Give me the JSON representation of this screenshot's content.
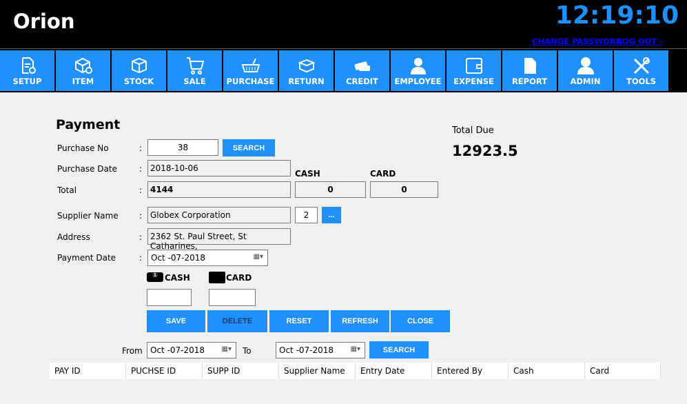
{
  "app": {
    "title": "Orion",
    "clock": "12:19:10",
    "change_password": "CHANGE PASSWORD",
    "logout": "LOG OUT - admin"
  },
  "nav": [
    {
      "label": "SETUP",
      "icon": "setup-document-gear-icon"
    },
    {
      "label": "ITEM",
      "icon": "item-box-icon"
    },
    {
      "label": "STOCK",
      "icon": "stock-box-icon"
    },
    {
      "label": "SALE",
      "icon": "cart-icon"
    },
    {
      "label": "PURCHASE",
      "icon": "basket-icon"
    },
    {
      "label": "RETURN",
      "icon": "open-box-icon"
    },
    {
      "label": "CREDIT",
      "icon": "credit-card-icon"
    },
    {
      "label": "EMPLOYEE",
      "icon": "employee-icon"
    },
    {
      "label": "EXPENSE",
      "icon": "wallet-icon"
    },
    {
      "label": "REPORT",
      "icon": "document-icon"
    },
    {
      "label": "ADMIN",
      "icon": "user-icon"
    },
    {
      "label": "TOOLS",
      "icon": "tools-icon"
    }
  ],
  "form": {
    "title": "Payment",
    "colon": ":",
    "purchase_no_label": "Purchase No",
    "purchase_no": "38",
    "search": "SEARCH",
    "purchase_date_label": "Purchase Date",
    "purchase_date": "2018-10-06",
    "total_label": "Total",
    "total": "4144",
    "cash_label": "CASH",
    "cash_value": "0",
    "card_label": "CARD",
    "card_value": "0",
    "supplier_label": "Supplier Name",
    "supplier": "Globex Corporation",
    "supplier_id": "2",
    "browse": "...",
    "address_label": "Address",
    "address": "2362 St. Paul Street, St Catharines,",
    "payment_date_label": "Payment Date",
    "payment_date": "Oct -07-2018",
    "pay_cash_label": "CASH",
    "pay_card_label": "CARD",
    "pay_cash": "",
    "pay_card": ""
  },
  "total_due": {
    "label": "Total Due",
    "value": "12923.5"
  },
  "actions": {
    "save": "SAVE",
    "delete": "DELETE",
    "reset": "RESET",
    "refresh": "REFRESH",
    "close": "CLOSE"
  },
  "filter": {
    "from_label": "From",
    "from": "Oct -07-2018",
    "to_label": "To",
    "to": "Oct -07-2018",
    "search": "SEARCH"
  },
  "table": {
    "columns": [
      "PAY ID",
      "PUCHSE ID",
      "SUPP ID",
      "Supplier Name",
      "Entry Date",
      "Entered By",
      "Cash",
      "Card"
    ]
  },
  "colors": {
    "accent": "#2090fc",
    "clock": "#1e90ff",
    "link": "#0000ff"
  }
}
